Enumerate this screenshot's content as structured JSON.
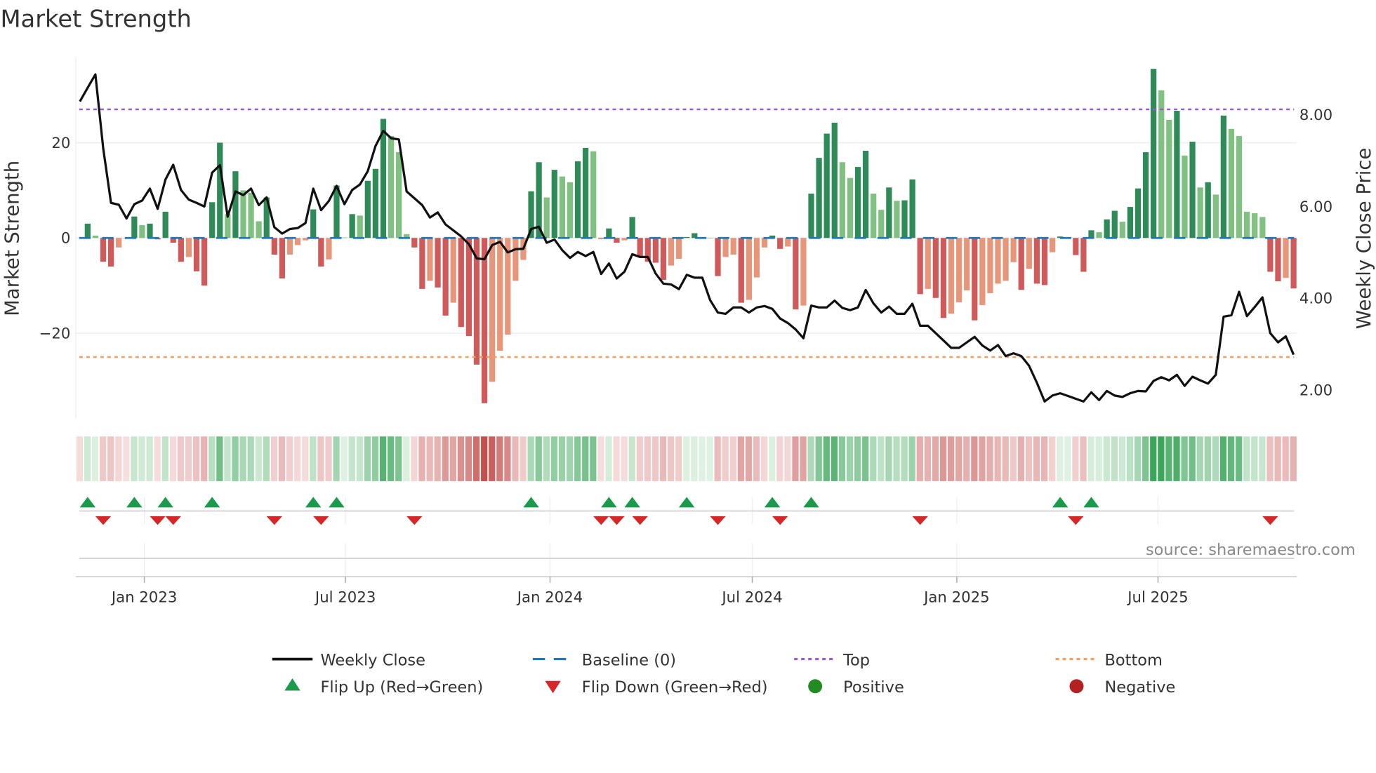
{
  "chart_data": {
    "type": "bar",
    "title": "Market Strength",
    "ylabel": "Market Strength",
    "y2label": "Weekly Close Price",
    "ylim": [
      -38,
      38
    ],
    "y2lim": [
      1.37,
      9.26
    ],
    "yticks": [
      {
        "value": 20,
        "label": "20"
      },
      {
        "value": 0,
        "label": "0"
      },
      {
        "value": -20,
        "label": "−20"
      }
    ],
    "y2ticks": [
      {
        "value": 8,
        "label": "8.00"
      },
      {
        "value": 6,
        "label": "6.00"
      },
      {
        "value": 4,
        "label": "4.00"
      },
      {
        "value": 2,
        "label": "2.00"
      }
    ],
    "xticks": [
      {
        "date": "2023-01-01",
        "label": "Jan 2023"
      },
      {
        "date": "2023-07-01",
        "label": "Jul 2023"
      },
      {
        "date": "2024-01-01",
        "label": "Jan 2024"
      },
      {
        "date": "2024-07-01",
        "label": "Jul 2024"
      },
      {
        "date": "2025-01-01",
        "label": "Jan 2025"
      },
      {
        "date": "2025-07-01",
        "label": "Jul 2025"
      }
    ],
    "start_date": "2022-11-04",
    "frequency": "weekly",
    "top_level": 27,
    "bottom_level": -25,
    "baseline": 0,
    "grid": true,
    "legend_placement": "bottom",
    "series": [
      {
        "name": "Market Strength",
        "type": "bar",
        "values": [
          null,
          3,
          0.5,
          -5,
          -6,
          -2,
          -0.1,
          4.5,
          2.7,
          3,
          -0.3,
          5.5,
          -1,
          -5,
          -4,
          -7,
          -10,
          7.5,
          20,
          5,
          14,
          10,
          9.5,
          3.5,
          8.5,
          -3.5,
          -8.5,
          -3.5,
          -1.5,
          -0.5,
          6,
          -6,
          -4.5,
          11,
          0.1,
          5,
          4.7,
          12,
          14.5,
          25,
          21.4,
          18,
          0.8,
          -2,
          -10.7,
          -9,
          -10.4,
          -16.3,
          -13.6,
          -18.7,
          -20.6,
          -26.6,
          -34.7,
          -30.2,
          -23.7,
          -20.3,
          -9,
          -4.6,
          9.8,
          15.9,
          8.5,
          14.3,
          12.9,
          11.7,
          16.1,
          18.9,
          18.2,
          -0.2,
          2,
          -1,
          -0.5,
          4.4,
          -4,
          -5,
          -5.2,
          -8.8,
          -5.8,
          -4.4,
          0.2,
          1,
          0.1,
          0.05,
          -8,
          -4,
          -3.5,
          -13.6,
          -13,
          -8.3,
          -2,
          0.5,
          -2.3,
          -1.8,
          -15,
          -14.2,
          9.3,
          16.8,
          21.9,
          24.2,
          15.9,
          12.6,
          14.9,
          18.3,
          9.3,
          5.9,
          10.6,
          7.8,
          7.9,
          12.3,
          -11.8,
          -10.7,
          -12.6,
          -16.8,
          -15.9,
          -13.5,
          -11,
          -17.3,
          -14.1,
          -11.6,
          -9.6,
          -9,
          -5.1,
          -10.9,
          -6.5,
          -9.6,
          -9.9,
          -3,
          0.3,
          0.1,
          -3.6,
          -7.1,
          1.6,
          1.2,
          3.9,
          5.7,
          3.4,
          6.5,
          10.4,
          18,
          35.5,
          31,
          24.8,
          26.7,
          17.3,
          20.2,
          10.6,
          11.7,
          9.1,
          25.7,
          22.9,
          21.4,
          5.5,
          5.2,
          4.4,
          -7.1,
          -9.1,
          -8.4,
          -10.6
        ]
      },
      {
        "name": "Weekly Close",
        "type": "line",
        "values": [
          8.29,
          8.59,
          8.88,
          7.27,
          6.08,
          6.04,
          5.74,
          6.05,
          6.13,
          6.39,
          5.95,
          6.59,
          6.91,
          6.36,
          6.15,
          6.08,
          6.0,
          6.74,
          6.9,
          5.78,
          6.33,
          6.25,
          6.39,
          6.03,
          6.2,
          5.55,
          5.41,
          5.51,
          5.53,
          5.64,
          6.39,
          5.92,
          6.12,
          6.45,
          6.05,
          6.36,
          6.48,
          6.77,
          7.32,
          7.65,
          7.49,
          7.46,
          6.33,
          6.18,
          6.03,
          5.76,
          5.87,
          5.61,
          5.48,
          5.35,
          5.18,
          4.87,
          4.85,
          5.16,
          5.23,
          5.0,
          5.07,
          5.08,
          5.51,
          5.56,
          5.21,
          5.28,
          5.05,
          4.88,
          5.01,
          4.92,
          5.01,
          4.53,
          4.76,
          4.43,
          4.58,
          4.96,
          4.9,
          4.9,
          4.54,
          4.32,
          4.3,
          4.2,
          4.51,
          4.45,
          4.45,
          3.96,
          3.69,
          3.66,
          3.8,
          3.8,
          3.69,
          3.8,
          3.83,
          3.77,
          3.56,
          3.46,
          3.32,
          3.13,
          3.84,
          3.8,
          3.8,
          3.95,
          3.79,
          3.74,
          3.8,
          4.18,
          3.89,
          3.69,
          3.82,
          3.66,
          3.66,
          3.88,
          3.4,
          3.4,
          3.24,
          3.08,
          2.92,
          2.92,
          3.04,
          3.16,
          2.97,
          2.86,
          2.98,
          2.74,
          2.8,
          2.74,
          2.53,
          2.16,
          1.75,
          1.88,
          1.93,
          1.87,
          1.81,
          1.75,
          1.95,
          1.78,
          1.98,
          1.88,
          1.85,
          1.93,
          1.98,
          1.97,
          2.2,
          2.28,
          2.21,
          2.33,
          2.09,
          2.29,
          2.21,
          2.14,
          2.33,
          3.6,
          3.63,
          4.14,
          3.61,
          3.81,
          4.02,
          3.24,
          3.04,
          3.17,
          2.77
        ]
      }
    ],
    "flip_up_weeks": [
      1,
      7,
      11,
      17,
      30,
      33,
      58,
      68,
      71,
      78,
      89,
      94,
      126,
      130
    ],
    "flip_down_weeks": [
      3,
      10,
      12,
      25,
      31,
      43,
      67,
      69,
      72,
      82,
      90,
      108,
      128,
      153
    ],
    "legend": {
      "weekly_close": "Weekly Close",
      "baseline": "Baseline (0)",
      "top": "Top",
      "bottom": "Bottom",
      "flip_up": "Flip Up (Red→Green)",
      "flip_down": "Flip Down (Green→Red)",
      "positive": "Positive",
      "negative": "Negative"
    },
    "source": "source: sharemaestro.com"
  },
  "colors": {
    "up_strong": "#2e8b57",
    "up_weak": "#80c080",
    "down_strong": "#d05a5a",
    "down_weak": "#e8967a",
    "baseline": "#1f77b4",
    "top": "#9b59d0",
    "bottom": "#f0a060",
    "flip_up": "#1a9a4a",
    "flip_down": "#d62728",
    "positive": "#228b22",
    "negative": "#b22222",
    "price": "#111111"
  }
}
